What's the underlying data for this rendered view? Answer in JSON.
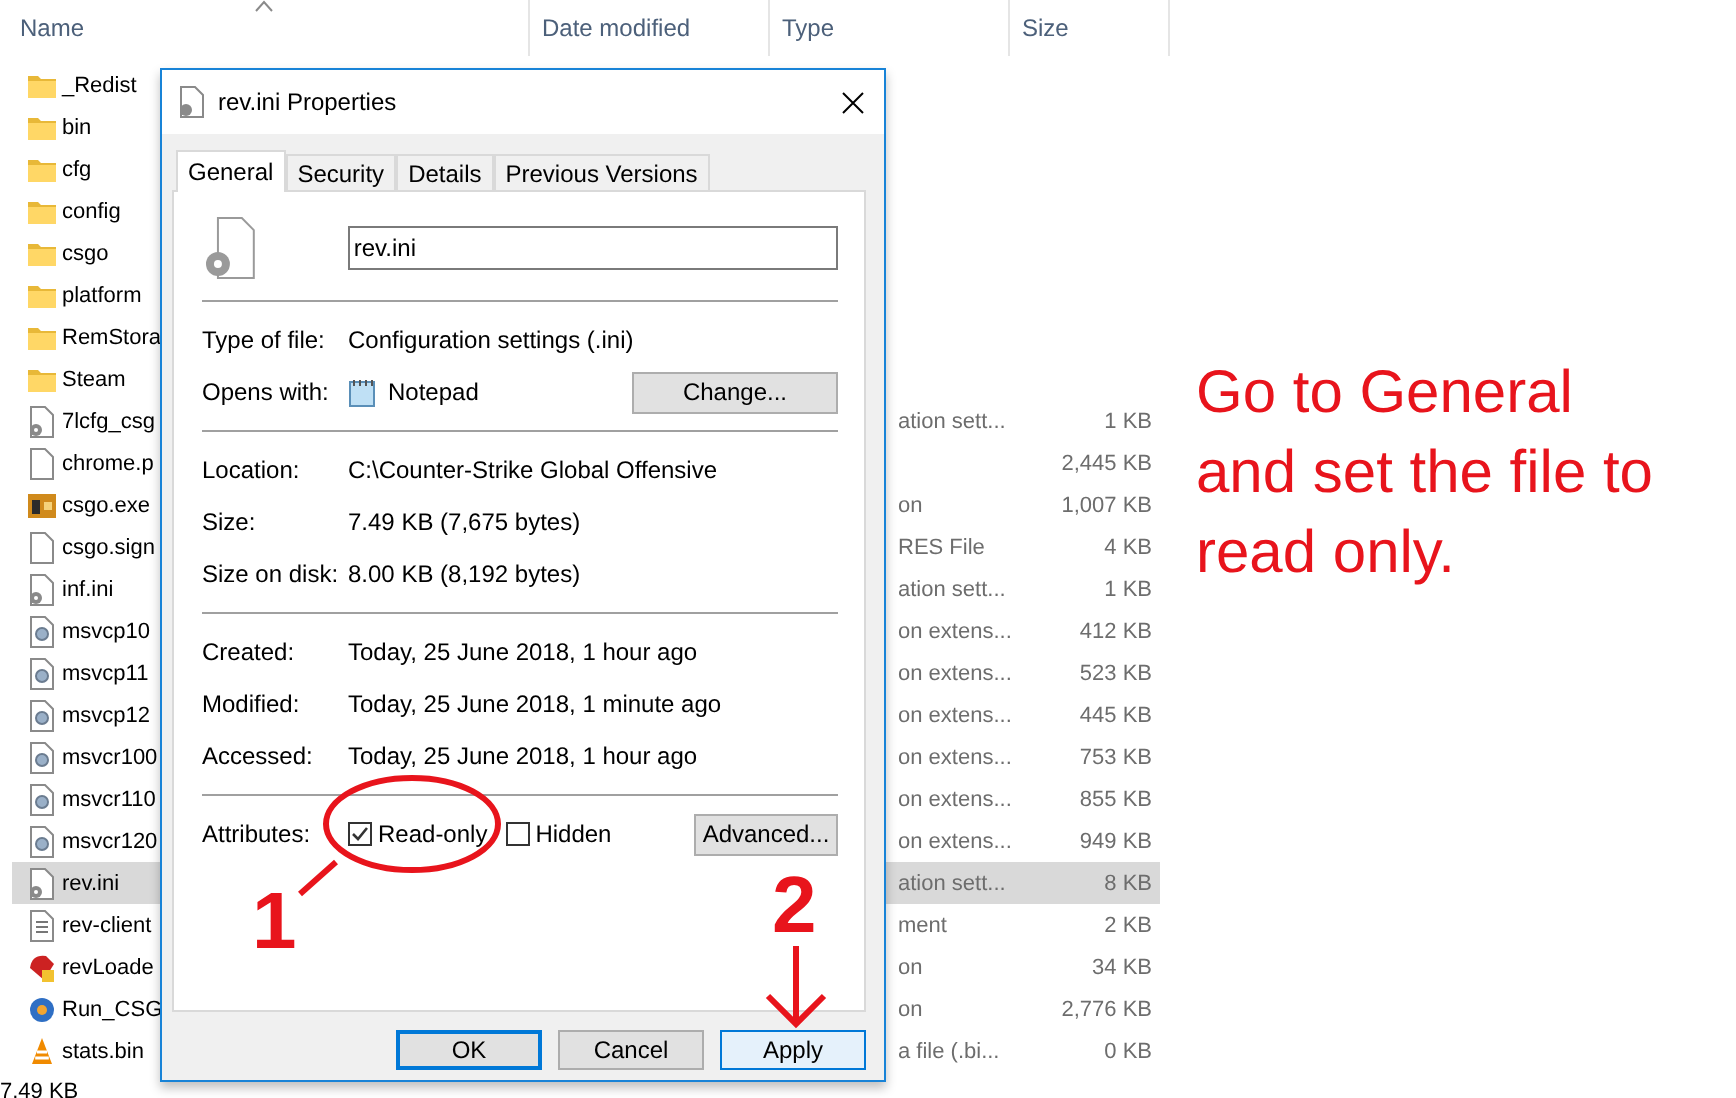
{
  "explorer": {
    "columns": [
      {
        "label": "Name",
        "sorted": true
      },
      {
        "label": "Date modified",
        "sorted": false
      },
      {
        "label": "Type",
        "sorted": false
      },
      {
        "label": "Size",
        "sorted": false
      }
    ],
    "rows": [
      {
        "name": "_Redist",
        "kind": "folder",
        "selected": false
      },
      {
        "name": "bin",
        "kind": "folder",
        "selected": false
      },
      {
        "name": "cfg",
        "kind": "folder",
        "selected": false
      },
      {
        "name": "config",
        "kind": "folder",
        "selected": false
      },
      {
        "name": "csgo",
        "kind": "folder",
        "selected": false
      },
      {
        "name": "platform",
        "kind": "folder",
        "selected": false
      },
      {
        "name": "RemStora",
        "kind": "folder",
        "selected": false
      },
      {
        "name": "Steam",
        "kind": "folder",
        "selected": false
      },
      {
        "name": "7lcfg_csg",
        "kind": "settings",
        "type": "ation sett...",
        "size": "1 KB",
        "selected": false
      },
      {
        "name": "chrome.p",
        "kind": "blank",
        "size": "2,445 KB",
        "selected": false
      },
      {
        "name": "csgo.exe",
        "kind": "game",
        "type": "on",
        "size": "1,007 KB",
        "selected": false
      },
      {
        "name": "csgo.sign",
        "kind": "blank",
        "type": "RES File",
        "size": "4 KB",
        "selected": false
      },
      {
        "name": "inf.ini",
        "kind": "settings",
        "type": "ation sett...",
        "size": "1 KB",
        "selected": false
      },
      {
        "name": "msvcp10",
        "kind": "library",
        "type": "on extens...",
        "size": "412 KB",
        "selected": false
      },
      {
        "name": "msvcp11",
        "kind": "library",
        "type": "on extens...",
        "size": "523 KB",
        "selected": false
      },
      {
        "name": "msvcp12",
        "kind": "library",
        "type": "on extens...",
        "size": "445 KB",
        "selected": false
      },
      {
        "name": "msvcr100",
        "kind": "library",
        "type": "on extens...",
        "size": "753 KB",
        "selected": false
      },
      {
        "name": "msvcr110",
        "kind": "library",
        "type": "on extens...",
        "size": "855 KB",
        "selected": false
      },
      {
        "name": "msvcr120",
        "kind": "library",
        "type": "on extens...",
        "size": "949 KB",
        "selected": false
      },
      {
        "name": "rev.ini",
        "kind": "settings",
        "type": "ation sett...",
        "size": "8 KB",
        "selected": true
      },
      {
        "name": "rev-client",
        "kind": "text",
        "type": "ment",
        "size": "2 KB",
        "selected": false
      },
      {
        "name": "revLoade",
        "kind": "red-app",
        "type": "on",
        "size": "34 KB",
        "selected": false
      },
      {
        "name": "Run_CSG",
        "kind": "blue-app",
        "type": "on",
        "size": "2,776 KB",
        "selected": false
      },
      {
        "name": "stats.bin",
        "kind": "cone",
        "type": "a file (.bi...",
        "size": "0 KB",
        "selected": false
      }
    ],
    "status_bar": "7.49 KB"
  },
  "dialog": {
    "title": "rev.ini Properties",
    "tabs": [
      {
        "label": "General",
        "selected": true
      },
      {
        "label": "Security",
        "selected": false
      },
      {
        "label": "Details",
        "selected": false
      },
      {
        "label": "Previous Versions",
        "selected": false
      }
    ],
    "file_name": "rev.ini",
    "sections": [
      [
        {
          "label": "Type of file:",
          "value": "Configuration settings (.ini)"
        },
        {
          "label": "Opens with:",
          "value": "Notepad",
          "button": "Change..."
        }
      ],
      [
        {
          "label": "Location:",
          "value": "C:\\Counter-Strike Global Offensive"
        },
        {
          "label": "Size:",
          "value": "7.49 KB (7,675 bytes)"
        },
        {
          "label": "Size on disk:",
          "value": "8.00 KB (8,192 bytes)"
        }
      ],
      [
        {
          "label": "Created:",
          "value": "Today, 25 June 2018, 1 hour ago"
        },
        {
          "label": "Modified:",
          "value": "Today, 25 June 2018, 1 minute ago"
        },
        {
          "label": "Accessed:",
          "value": "Today, 25 June 2018, 1 hour ago"
        }
      ]
    ],
    "attributes": {
      "label": "Attributes:",
      "options": [
        {
          "label": "Read-only",
          "checked": true
        },
        {
          "label": "Hidden",
          "checked": false
        }
      ],
      "button": "Advanced..."
    },
    "buttons": [
      {
        "label": "OK",
        "kind": "default"
      },
      {
        "label": "Cancel",
        "kind": "normal"
      },
      {
        "label": "Apply",
        "kind": "hover"
      }
    ]
  },
  "annotation": {
    "note": "Go to General\nand set the file to\nread only.",
    "step_1": "1",
    "step_2": "2"
  }
}
